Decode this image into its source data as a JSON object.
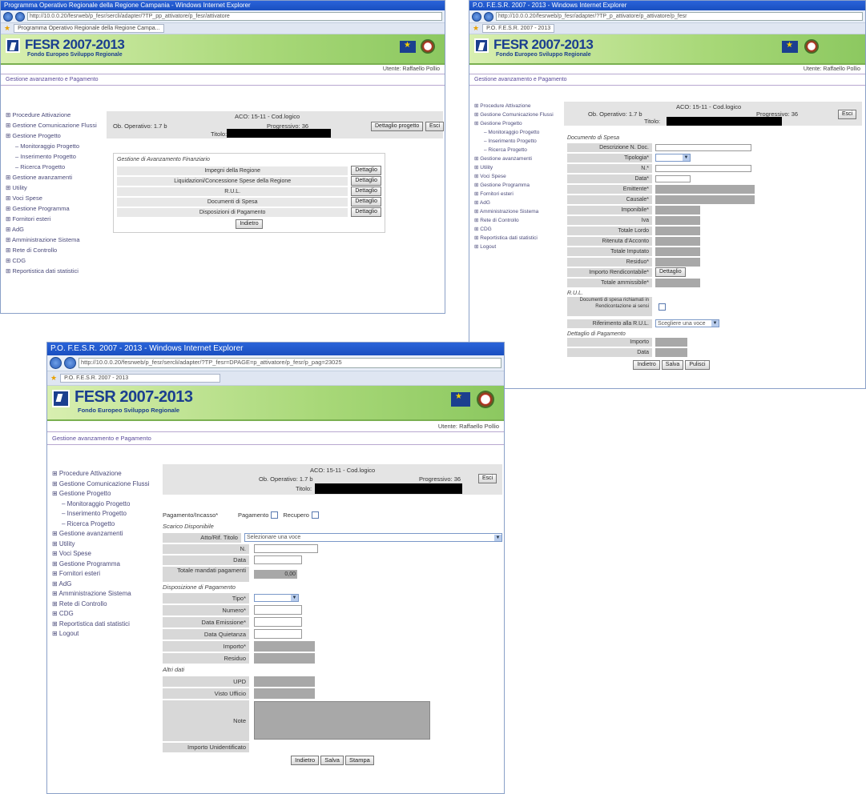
{
  "win1": {
    "titlebar": "Programma Operativo Regionale della Regione Campania - Windows Internet Explorer",
    "url": "http://10.0.0.20/fesrweb/p_fesr/sercli/adapter/?TP_pp_attivatore/p_fesr/attivatore",
    "tab": "Programma Operativo Regionale della Regione Campa...",
    "banner_title": "FESR 2007-2013",
    "banner_subtitle": "Fondo Europeo Sviluppo Regionale",
    "user": "Utente: Raffaello Pollio",
    "breadcrumb": "Gestione avanzamento e Pagamento",
    "sidebar": [
      {
        "label": "Procedure Attivazione",
        "sub": false
      },
      {
        "label": "Gestione Comunicazione Flussi",
        "sub": false
      },
      {
        "label": "Gestione Progetto",
        "sub": false
      },
      {
        "label": "Monitoraggio Progetto",
        "sub": true
      },
      {
        "label": "Inserimento Progetto",
        "sub": true
      },
      {
        "label": "Ricerca Progetto",
        "sub": true
      },
      {
        "label": "Gestione avanzamenti",
        "sub": false
      },
      {
        "label": "Utility",
        "sub": false
      },
      {
        "label": "Voci Spese",
        "sub": false
      },
      {
        "label": "Gestione Programma",
        "sub": false
      },
      {
        "label": "Fornitori esteri",
        "sub": false
      },
      {
        "label": "AdG",
        "sub": false
      },
      {
        "label": "Amministrazione Sistema",
        "sub": false
      },
      {
        "label": "Rete di Controllo",
        "sub": false
      },
      {
        "label": "CDG",
        "sub": false
      },
      {
        "label": "Reportistica dati statistici",
        "sub": false
      }
    ],
    "header": {
      "aco": "ACO: 15-11 - Cod.logico",
      "ob_operativo": "Ob. Operativo: 1.7 b",
      "progressivo": "Progressivo: 36",
      "titolo": "Titolo:",
      "btn_dettaglio": "Dettaglio progetto",
      "btn_esci": "Esci"
    },
    "section_title": "Gestione di Avanzamento Finanziario",
    "table": [
      {
        "label": "Impegni della Regione",
        "btn": "Dettaglio"
      },
      {
        "label": "Liquidazioni/Concessione Spese della Regione",
        "btn": "Dettaglio"
      },
      {
        "label": "R.U.L.",
        "btn": "Dettaglio"
      },
      {
        "label": "Documenti di Spesa",
        "btn": "Dettaglio"
      },
      {
        "label": "Disposizioni di Pagamento",
        "btn": "Dettaglio"
      }
    ],
    "btn_indietro": "Indietro"
  },
  "win2": {
    "titlebar": "P.O. F.E.S.R. 2007 - 2013 - Windows Internet Explorer",
    "url": "http://10.0.0.20/fesrweb/p_fesr/adapter/?TP_p_attivatore/p_attivatore/p_fesr",
    "tab": "P.O. F.E.S.R. 2007 - 2013",
    "banner_title": "FESR 2007-2013",
    "banner_subtitle": "Fondo Europeo Sviluppo Regionale",
    "user": "Utente: Raffaello Pollio",
    "breadcrumb": "Gestione avanzamento e Pagamento",
    "sidebar": [
      {
        "label": "Procedure Attivazione",
        "sub": false
      },
      {
        "label": "Gestione Comunicazione Flussi",
        "sub": false
      },
      {
        "label": "Gestione Progetto",
        "sub": false
      },
      {
        "label": "Monitoraggio Progetto",
        "sub": true
      },
      {
        "label": "Inserimento Progetto",
        "sub": true
      },
      {
        "label": "Ricerca Progetto",
        "sub": true
      },
      {
        "label": "Gestione avanzamenti",
        "sub": false
      },
      {
        "label": "Utility",
        "sub": false
      },
      {
        "label": "Voci Spese",
        "sub": false
      },
      {
        "label": "Gestione Programma",
        "sub": false
      },
      {
        "label": "Fornitori esteri",
        "sub": false
      },
      {
        "label": "AdG",
        "sub": false
      },
      {
        "label": "Amministrazione Sistema",
        "sub": false
      },
      {
        "label": "Rete di Controllo",
        "sub": false
      },
      {
        "label": "CDG",
        "sub": false
      },
      {
        "label": "Reportistica dati statistici",
        "sub": false
      },
      {
        "label": "Logout",
        "sub": false
      }
    ],
    "header": {
      "aco": "ACO: 15-11 - Cod.logico",
      "ob_operativo": "Ob. Operativo: 1.7 b",
      "progressivo": "Progressivo: 36",
      "titolo": "Titolo:",
      "btn_esci": "Esci"
    },
    "section_title": "Documento di Spesa",
    "fields": [
      {
        "label": "Descrizione N. Doc.",
        "kind": "input"
      },
      {
        "label": "Tipologia*",
        "kind": "select"
      },
      {
        "label": "N.*",
        "kind": "input"
      },
      {
        "label": "Data*",
        "kind": "input-short"
      },
      {
        "label": "Emittente*",
        "kind": "grey-long"
      },
      {
        "label": "Causale*",
        "kind": "grey-long"
      },
      {
        "label": "Imponibile*",
        "kind": "grey"
      },
      {
        "label": "Iva",
        "kind": "grey"
      },
      {
        "label": "Totale Lordo",
        "kind": "grey"
      },
      {
        "label": "Ritenuta d'Acconto",
        "kind": "grey"
      },
      {
        "label": "Totale Imputato",
        "kind": "grey"
      },
      {
        "label": "Residuo*",
        "kind": "grey"
      },
      {
        "label": "Importo Rendicontabile*",
        "kind": "button"
      },
      {
        "label": "Totale ammissibile*",
        "kind": "grey"
      }
    ],
    "btn_dettaglio": "Dettaglio",
    "rul_title": "R.U.L.",
    "rul_text": "Documenti di spesa richiamati in Rendicontazione ai sensi",
    "rul_select": "Scegliere una voce",
    "rul_label": "Riferimento alla R.U.L.",
    "pag_title": "Dettaglio di Pagamento",
    "pag_fields": [
      "Importo",
      "Data"
    ],
    "buttons": [
      "Indietro",
      "Salva",
      "Pulisci"
    ]
  },
  "win3": {
    "titlebar": "P.O. F.E.S.R. 2007 - 2013 - Windows Internet Explorer",
    "url": "http://10.0.0.20/fesrweb/p_fesr/sercli/adapter/?TP_fesr=DPAGE=p_attivatore/p_fesr/p_pag=23025",
    "tab": "P.O. F.E.S.R. 2007 - 2013",
    "banner_title": "FESR 2007-2013",
    "banner_subtitle": "Fondo Europeo Sviluppo Regionale",
    "user": "Utente: Raffaello Pollio",
    "breadcrumb": "Gestione avanzamento e Pagamento",
    "sidebar": [
      {
        "label": "Procedure Attivazione",
        "sub": false
      },
      {
        "label": "Gestione Comunicazione Flussi",
        "sub": false
      },
      {
        "label": "Gestione Progetto",
        "sub": false
      },
      {
        "label": "Monitoraggio Progetto",
        "sub": true
      },
      {
        "label": "Inserimento Progetto",
        "sub": true
      },
      {
        "label": "Ricerca Progetto",
        "sub": true
      },
      {
        "label": "Gestione avanzamenti",
        "sub": false
      },
      {
        "label": "Utility",
        "sub": false
      },
      {
        "label": "Voci Spese",
        "sub": false
      },
      {
        "label": "Gestione Programma",
        "sub": false
      },
      {
        "label": "Fornitori esteri",
        "sub": false
      },
      {
        "label": "AdG",
        "sub": false
      },
      {
        "label": "Amministrazione Sistema",
        "sub": false
      },
      {
        "label": "Rete di Controllo",
        "sub": false
      },
      {
        "label": "CDG",
        "sub": false
      },
      {
        "label": "Reportistica dati statistici",
        "sub": false
      },
      {
        "label": "Logout",
        "sub": false
      }
    ],
    "header": {
      "aco": "ACO: 15-11 - Cod.logico",
      "ob_operativo": "Ob. Operativo: 1.7 b",
      "progressivo": "Progressivo: 36",
      "titolo": "Titolo:",
      "btn_esci": "Esci"
    },
    "pagamento": {
      "label": "Pagamento/Incasso*",
      "opt1": "Pagamento",
      "opt2": "Recupero"
    },
    "sec_scarico": "Scarico Disponibile",
    "atto_label": "Atto/Rif. Titolo",
    "atto_select": "Selezionare una voce",
    "scarico_fields": [
      "N.",
      "Data",
      "Totale mandati pagamenti"
    ],
    "totale_value": "0,00",
    "sec_disposizione": "Disposizione di Pagamento",
    "disp_fields": [
      {
        "label": "Tipo*",
        "kind": "select"
      },
      {
        "label": "Numero*",
        "kind": "input"
      },
      {
        "label": "Data Emissione*",
        "kind": "input"
      },
      {
        "label": "Data Quietanza",
        "kind": "input"
      },
      {
        "label": "Importo*",
        "kind": "grey"
      },
      {
        "label": "Residuo",
        "kind": "grey"
      }
    ],
    "sec_altri": "Altri dati",
    "altri_fields": [
      "UPD",
      "Visto Ufficio"
    ],
    "note_label": "Note",
    "importo_label": "Importo Unidentificato",
    "buttons": [
      "Indietro",
      "Salva",
      "Stampa"
    ]
  }
}
